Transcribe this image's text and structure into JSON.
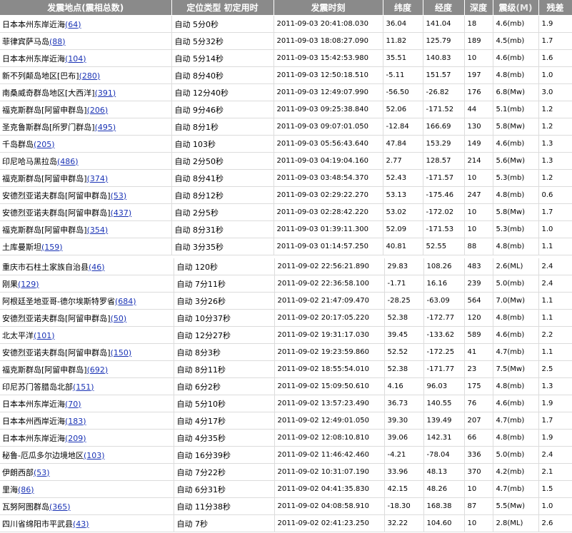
{
  "header": {
    "location": "发震地点(震相总数)",
    "type": "定位类型  初定用时",
    "time": "发震时刻",
    "lat": "纬度",
    "lon": "经度",
    "depth": "深度",
    "magnitude": "震级",
    "magnitude_unit": "(M)",
    "residual": "残差"
  },
  "rows_0903": [
    {
      "loc": "日本本州东岸近海",
      "cnt": "(64)",
      "type": "自动 5分0秒",
      "time": "2011-09-03 20:41:08.030",
      "lat": "36.04",
      "lon": "141.04",
      "depth": "18",
      "mag": "4.6(mb)",
      "res": "1.9"
    },
    {
      "loc": "菲律宾萨马岛",
      "cnt": "(88)",
      "type": "自动 5分32秒",
      "time": "2011-09-03 18:08:27.090",
      "lat": "11.82",
      "lon": "125.79",
      "depth": "189",
      "mag": "4.5(mb)",
      "res": "1.7"
    },
    {
      "loc": "日本本州东岸近海",
      "cnt": "(104)",
      "type": "自动 5分14秒",
      "time": "2011-09-03 15:42:53.980",
      "lat": "35.51",
      "lon": "140.83",
      "depth": "10",
      "mag": "4.6(mb)",
      "res": "1.6"
    },
    {
      "loc": "新不列颠岛地区[巴布]",
      "cnt": "(280)",
      "type": "自动 8分40秒",
      "time": "2011-09-03 12:50:18.510",
      "lat": "-5.11",
      "lon": "151.57",
      "depth": "197",
      "mag": "4.8(mb)",
      "res": "1.0"
    },
    {
      "loc": "南桑威奇群岛地区[大西洋]",
      "cnt": "(391)",
      "type": "自动 12分40秒",
      "time": "2011-09-03 12:49:07.990",
      "lat": "-56.50",
      "lon": "-26.82",
      "depth": "176",
      "mag": "6.8(Mw)",
      "res": "3.0"
    },
    {
      "loc": "福克斯群岛[阿留申群岛]",
      "cnt": "(206)",
      "type": "自动 9分46秒",
      "time": "2011-09-03 09:25:38.840",
      "lat": "52.06",
      "lon": "-171.52",
      "depth": "44",
      "mag": "5.1(mb)",
      "res": "1.2"
    },
    {
      "loc": "圣克鲁斯群岛[所罗门群岛]",
      "cnt": "(495)",
      "type": "自动 8分1秒",
      "time": "2011-09-03 09:07:01.050",
      "lat": "-12.84",
      "lon": "166.69",
      "depth": "130",
      "mag": "5.8(Mw)",
      "res": "1.2"
    },
    {
      "loc": "千岛群岛",
      "cnt": "(205)",
      "type": "自动 103秒",
      "time": "2011-09-03 05:56:43.640",
      "lat": "47.84",
      "lon": "153.29",
      "depth": "149",
      "mag": "4.6(mb)",
      "res": "1.3"
    },
    {
      "loc": "印尼哈马黑拉岛",
      "cnt": "(486)",
      "type": "自动 2分50秒",
      "time": "2011-09-03 04:19:04.160",
      "lat": "2.77",
      "lon": "128.57",
      "depth": "214",
      "mag": "5.6(Mw)",
      "res": "1.3"
    },
    {
      "loc": "福克斯群岛[阿留申群岛]",
      "cnt": "(374)",
      "type": "自动 8分41秒",
      "time": "2011-09-03 03:48:54.370",
      "lat": "52.43",
      "lon": "-171.57",
      "depth": "10",
      "mag": "5.3(mb)",
      "res": "1.2"
    },
    {
      "loc": "安德烈亚诺夫群岛[阿留申群岛]",
      "cnt": "(53)",
      "type": "自动 8分12秒",
      "time": "2011-09-03 02:29:22.270",
      "lat": "53.13",
      "lon": "-175.46",
      "depth": "247",
      "mag": "4.8(mb)",
      "res": "0.6"
    },
    {
      "loc": "安德烈亚诺夫群岛[阿留申群岛]",
      "cnt": "(437)",
      "type": "自动 2分5秒",
      "time": "2011-09-03 02:28:42.220",
      "lat": "53.02",
      "lon": "-172.02",
      "depth": "10",
      "mag": "5.8(Mw)",
      "res": "1.7"
    },
    {
      "loc": "福克斯群岛[阿留申群岛]",
      "cnt": "(354)",
      "type": "自动 8分31秒",
      "time": "2011-09-03 01:39:11.300",
      "lat": "52.09",
      "lon": "-171.53",
      "depth": "10",
      "mag": "5.3(mb)",
      "res": "1.0"
    },
    {
      "loc": "土库曼斯坦",
      "cnt": "(159)",
      "type": "自动 3分35秒",
      "time": "2011-09-03 01:14:57.250",
      "lat": "40.81",
      "lon": "52.55",
      "depth": "88",
      "mag": "4.8(mb)",
      "res": "1.1"
    }
  ],
  "rows_0902": [
    {
      "loc": "重庆市石柱土家族自治县",
      "cnt": "(46)",
      "type": "自动 120秒",
      "time": "2011-09-02 22:56:21.890",
      "lat": "29.83",
      "lon": "108.26",
      "depth": "483",
      "mag": "2.6(ML)",
      "res": "2.4"
    },
    {
      "loc": "刚果",
      "cnt": "(129)",
      "type": "自动 7分11秒",
      "time": "2011-09-02 22:36:58.100",
      "lat": "-1.71",
      "lon": "16.16",
      "depth": "239",
      "mag": "5.0(mb)",
      "res": "2.4"
    },
    {
      "loc": "阿根廷圣地亚哥-德尔埃斯特罗省",
      "cnt": "(684)",
      "type": "自动 3分26秒",
      "time": "2011-09-02 21:47:09.470",
      "lat": "-28.25",
      "lon": "-63.09",
      "depth": "564",
      "mag": "7.0(Mw)",
      "res": "1.1"
    },
    {
      "loc": "安德烈亚诺夫群岛[阿留申群岛]",
      "cnt": "(50)",
      "type": "自动 10分37秒",
      "time": "2011-09-02 20:17:05.220",
      "lat": "52.38",
      "lon": "-172.77",
      "depth": "120",
      "mag": "4.8(mb)",
      "res": "1.1"
    },
    {
      "loc": "北太平洋",
      "cnt": "(101)",
      "type": "自动 12分27秒",
      "time": "2011-09-02 19:31:17.030",
      "lat": "39.45",
      "lon": "-133.62",
      "depth": "589",
      "mag": "4.6(mb)",
      "res": "2.2"
    },
    {
      "loc": "安德烈亚诺夫群岛[阿留申群岛]",
      "cnt": "(150)",
      "type": "自动 8分3秒",
      "time": "2011-09-02 19:23:59.860",
      "lat": "52.52",
      "lon": "-172.25",
      "depth": "41",
      "mag": "4.7(mb)",
      "res": "1.1"
    },
    {
      "loc": "福克斯群岛[阿留申群岛]",
      "cnt": "(692)",
      "type": "自动 8分11秒",
      "time": "2011-09-02 18:55:54.010",
      "lat": "52.38",
      "lon": "-171.77",
      "depth": "23",
      "mag": "7.5(Mw)",
      "res": "2.5"
    },
    {
      "loc": "印尼苏门答腊岛北部",
      "cnt": "(151)",
      "type": "自动 6分2秒",
      "time": "2011-09-02 15:09:50.610",
      "lat": "4.16",
      "lon": "96.03",
      "depth": "175",
      "mag": "4.8(mb)",
      "res": "1.3"
    },
    {
      "loc": "日本本州东岸近海",
      "cnt": "(70)",
      "type": "自动 5分10秒",
      "time": "2011-09-02 13:57:23.490",
      "lat": "36.73",
      "lon": "140.55",
      "depth": "76",
      "mag": "4.6(mb)",
      "res": "1.9"
    },
    {
      "loc": "日本本州西岸近海",
      "cnt": "(183)",
      "type": "自动 4分17秒",
      "time": "2011-09-02 12:49:01.050",
      "lat": "39.30",
      "lon": "139.49",
      "depth": "207",
      "mag": "4.7(mb)",
      "res": "1.7"
    },
    {
      "loc": "日本本州东岸近海",
      "cnt": "(209)",
      "type": "自动 4分35秒",
      "time": "2011-09-02 12:08:10.810",
      "lat": "39.06",
      "lon": "142.31",
      "depth": "66",
      "mag": "4.8(mb)",
      "res": "1.9"
    },
    {
      "loc": "秘鲁-厄瓜多尔边境地区",
      "cnt": "(103)",
      "type": "自动 16分39秒",
      "time": "2011-09-02 11:46:42.460",
      "lat": "-4.21",
      "lon": "-78.04",
      "depth": "336",
      "mag": "5.0(mb)",
      "res": "2.4"
    },
    {
      "loc": "伊朗西部",
      "cnt": "(53)",
      "type": "自动 7分22秒",
      "time": "2011-09-02 10:31:07.190",
      "lat": "33.96",
      "lon": "48.13",
      "depth": "370",
      "mag": "4.2(mb)",
      "res": "2.1"
    },
    {
      "loc": "里海",
      "cnt": "(86)",
      "type": "自动 6分31秒",
      "time": "2011-09-02 04:41:35.830",
      "lat": "42.15",
      "lon": "48.26",
      "depth": "10",
      "mag": "4.7(mb)",
      "res": "1.5"
    },
    {
      "loc": "瓦努阿图群岛",
      "cnt": "(365)",
      "type": "自动 11分38秒",
      "time": "2011-09-02 04:08:58.910",
      "lat": "-18.30",
      "lon": "168.38",
      "depth": "87",
      "mag": "5.5(Mw)",
      "res": "1.0"
    },
    {
      "loc": "四川省绵阳市平武县",
      "cnt": "(43)",
      "type": "自动 7秒",
      "time": "2011-09-02 02:41:23.250",
      "lat": "32.22",
      "lon": "104.60",
      "depth": "10",
      "mag": "2.8(ML)",
      "res": "2.6"
    }
  ]
}
